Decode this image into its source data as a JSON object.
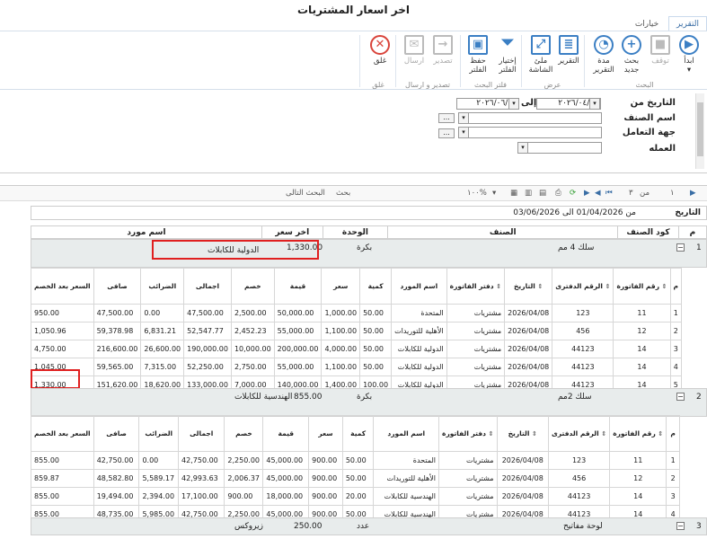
{
  "window": {
    "title": "اخر اسعار المشتريات"
  },
  "ribbon": {
    "tabs": [
      "التقرير",
      "خيارات"
    ],
    "buttons": {
      "start": "ابدأ",
      "stop": "توقف",
      "new_search": "بحث جديد",
      "report_period": "مدة التقرير",
      "report": "التقرير",
      "fullscreen": "ملئ الشاشة",
      "select_filter": "إختيار الفلتر",
      "save_filter": "حفظ الفلتر",
      "export": "تصدير",
      "send": "ارسال",
      "close": "غلق"
    },
    "groups": {
      "search": "البحث",
      "view": "عرض",
      "search_filter": "فلتر البحث",
      "export_send": "تصدير و ارسال",
      "close": "غلق"
    }
  },
  "filter": {
    "date_from_label": "التاريخ من",
    "date_from": "٢٠٢٦/٠٤/٠١",
    "to_label": "إلى",
    "date_to": "٢٠٢٦/٠٦/٠٣",
    "item_name_label": "اسم الصنف",
    "dealer_label": "جهة التعامل",
    "currency_label": "العمله"
  },
  "toolbar": {
    "search": "بحث",
    "next_search": "البحث التالى",
    "zoom": "١٠٠%",
    "page": "١",
    "of_label": "من",
    "total": "٣"
  },
  "report": {
    "date_label": "التاريخ",
    "date_range": "من 01/04/2026 الى 03/06/2026"
  },
  "grid": {
    "headers": {
      "m": "م",
      "item_code": "كود الصنف",
      "item": "الصنف",
      "unit": "الوحدة",
      "last_price": "اخر سعر",
      "supplier": "اسم مورد"
    },
    "sub_headers": {
      "m": "م",
      "inv_no": "رقم الفاتورة",
      "book_no": "الرقم الدفترى",
      "date": "التاريخ",
      "inv_book": "دفتر الفاتورة",
      "supplier": "اسم المورد",
      "qty": "كمية",
      "price": "سعر",
      "value": "قيمة",
      "discount": "خصم",
      "total": "اجمالى",
      "taxes": "الضرائب",
      "net": "صافى",
      "price_after": "السعر بعد الخصم"
    },
    "groups": [
      {
        "m": "1",
        "item": "سلك 4 مم",
        "unit": "بكرة",
        "last_price": "1,330.00",
        "supplier": "الدولية للكابلات",
        "rows": [
          [
            "1",
            "11",
            "123",
            "2026/04/08",
            "مشتريات",
            "المتحدة",
            "50.00",
            "1,000.00",
            "50,000.00",
            "2,500.00",
            "47,500.00",
            "0.00",
            "47,500.00",
            "950.00"
          ],
          [
            "2",
            "12",
            "456",
            "2026/04/08",
            "مشتريات",
            "الأهلية للتوريدات",
            "50.00",
            "1,100.00",
            "55,000.00",
            "2,452.23",
            "52,547.77",
            "6,831.21",
            "59,378.98",
            "1,050.96"
          ],
          [
            "3",
            "14",
            "44123",
            "2026/04/08",
            "مشتريات",
            "الدولية للكابلات",
            "50.00",
            "4,000.00",
            "200,000.00",
            "10,000.00",
            "190,000.00",
            "26,600.00",
            "216,600.00",
            "4,750.00"
          ],
          [
            "4",
            "14",
            "44123",
            "2026/04/08",
            "مشتريات",
            "الدولية للكابلات",
            "50.00",
            "1,100.00",
            "55,000.00",
            "2,750.00",
            "52,250.00",
            "7,315.00",
            "59,565.00",
            "1,045.00"
          ],
          [
            "5",
            "14",
            "44123",
            "2026/04/08",
            "مشتريات",
            "الدولية للكابلات",
            "100.00",
            "1,400.00",
            "140,000.00",
            "7,000.00",
            "133,000.00",
            "18,620.00",
            "151,620.00",
            "1,330.00"
          ]
        ]
      },
      {
        "m": "2",
        "item": "سلك 2مم",
        "unit": "بكرة",
        "last_price": "855.00",
        "supplier": "الهندسية للكابلات",
        "rows": [
          [
            "1",
            "11",
            "123",
            "2026/04/08",
            "مشتريات",
            "المتحدة",
            "50.00",
            "900.00",
            "45,000.00",
            "2,250.00",
            "42,750.00",
            "0.00",
            "42,750.00",
            "855.00"
          ],
          [
            "2",
            "12",
            "456",
            "2026/04/08",
            "مشتريات",
            "الأهلية للتوريدات",
            "50.00",
            "900.00",
            "45,000.00",
            "2,006.37",
            "42,993.63",
            "5,589.17",
            "48,582.80",
            "859.87"
          ],
          [
            "3",
            "14",
            "44123",
            "2026/04/08",
            "مشتريات",
            "الهندسية للكابلات",
            "20.00",
            "900.00",
            "18,000.00",
            "900.00",
            "17,100.00",
            "2,394.00",
            "19,494.00",
            "855.00"
          ],
          [
            "4",
            "14",
            "44123",
            "2026/04/08",
            "مشتريات",
            "الهندسية للكابلات",
            "50.00",
            "900.00",
            "45,000.00",
            "2,250.00",
            "42,750.00",
            "5,985.00",
            "48,735.00",
            "855.00"
          ]
        ]
      },
      {
        "m": "3",
        "item": "لوحة مفاتيح",
        "unit": "عدد",
        "last_price": "250.00",
        "supplier": "زيروكس"
      }
    ]
  }
}
